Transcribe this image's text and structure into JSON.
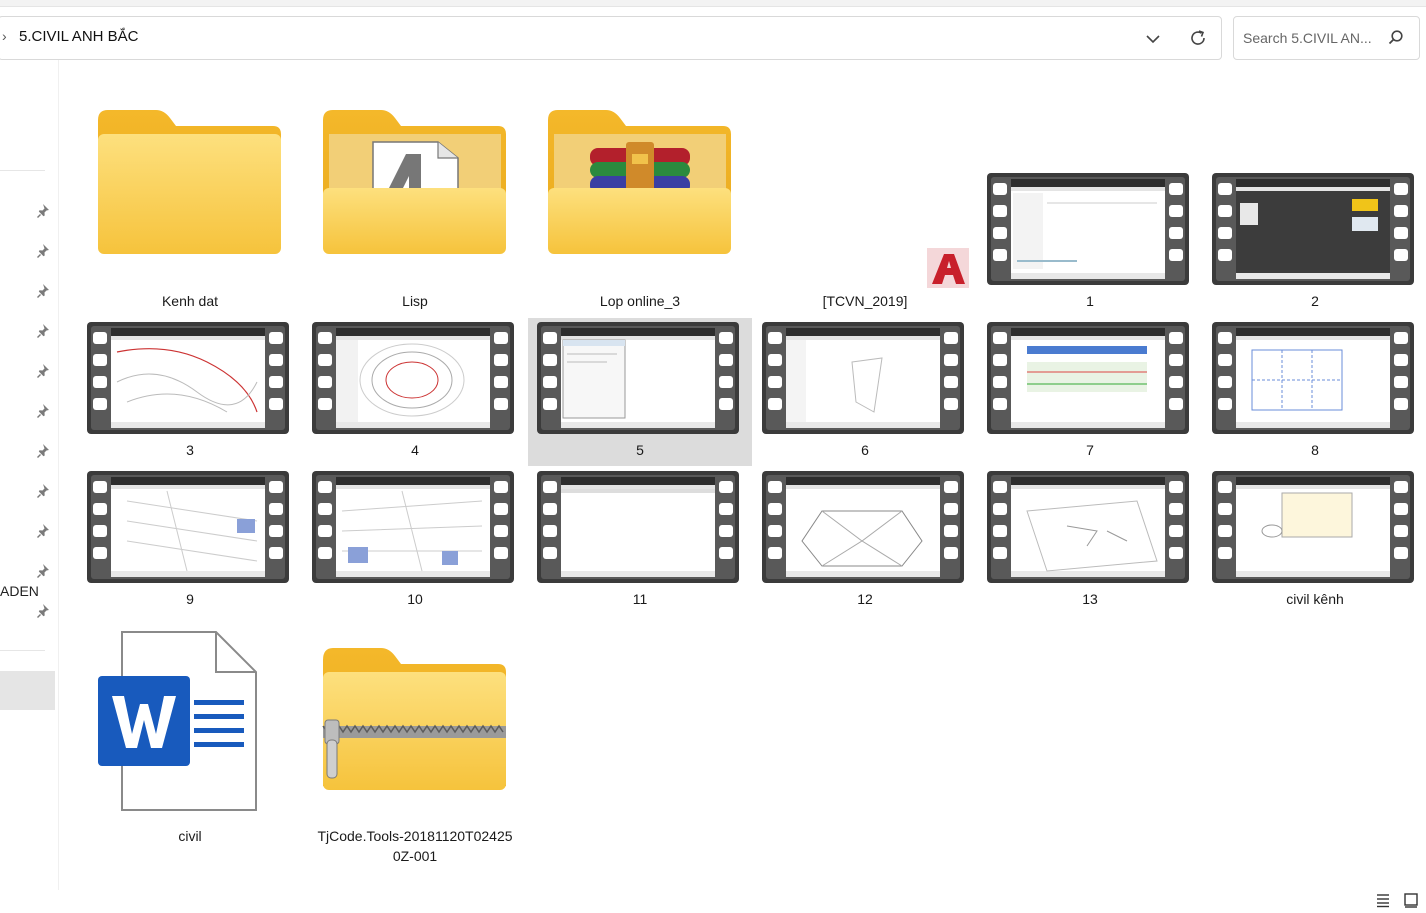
{
  "address": {
    "path": "5.CIVIL ANH BẮC"
  },
  "search": {
    "placeholder": "Search 5.CIVIL AN..."
  },
  "nav": {
    "visible_label": "ADEN"
  },
  "items": [
    {
      "name": "Kenh dat",
      "type": "folder"
    },
    {
      "name": "Lisp",
      "type": "folder-autocad"
    },
    {
      "name": "Lop online_3",
      "type": "folder-winrar"
    },
    {
      "name": "[TCVN_2019]",
      "type": "autocad-file"
    },
    {
      "name": "1",
      "type": "video"
    },
    {
      "name": "2",
      "type": "video"
    },
    {
      "name": "3",
      "type": "video"
    },
    {
      "name": "4",
      "type": "video"
    },
    {
      "name": "5",
      "type": "video",
      "selected": true
    },
    {
      "name": "6",
      "type": "video"
    },
    {
      "name": "7",
      "type": "video"
    },
    {
      "name": "8",
      "type": "video"
    },
    {
      "name": "9",
      "type": "video"
    },
    {
      "name": "10",
      "type": "video"
    },
    {
      "name": "11",
      "type": "video"
    },
    {
      "name": "12",
      "type": "video"
    },
    {
      "name": "13",
      "type": "video"
    },
    {
      "name": "civil kênh",
      "type": "video"
    },
    {
      "name": "civil",
      "type": "word-document"
    },
    {
      "name": "TjCode.Tools-20181120T024250Z-001",
      "name_line1": "TjCode.Tools-20181120T02425",
      "name_line2": "0Z-001",
      "type": "zip-folder"
    }
  ],
  "colors": {
    "folder": "#f8c948",
    "folder_light": "#fddc7a",
    "word_blue": "#185abd",
    "autocad_red": "#c8202b",
    "selection": "#dcdcdc"
  }
}
